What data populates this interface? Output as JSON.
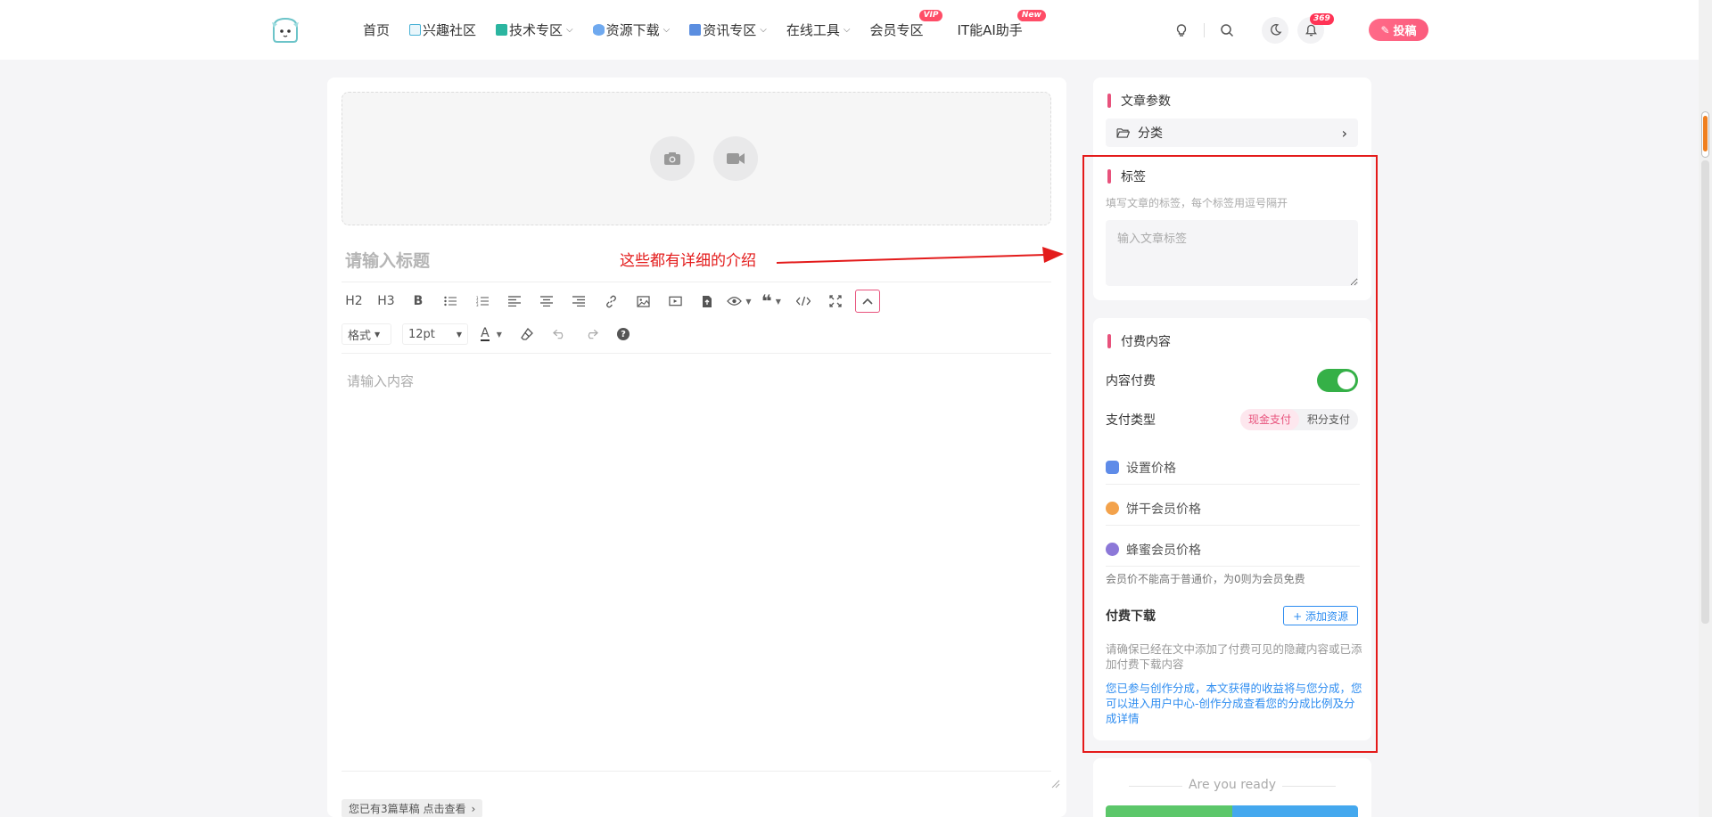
{
  "nav": {
    "home": "首页",
    "community": "兴趣社区",
    "tech": "技术专区",
    "resources": "资源下载",
    "news": "资讯专区",
    "tools": "在线工具",
    "vip": "会员专区",
    "vip_badge": "VIP",
    "ai": "IT能AI助手",
    "ai_badge": "New"
  },
  "header": {
    "notification_count": "369",
    "post_label": "投稿"
  },
  "editor": {
    "title_placeholder": "请输入标题",
    "annotation": "这些都有详细的介绍",
    "toolbar": {
      "h2": "H2",
      "h3": "H3",
      "bold": "B",
      "format": "格式",
      "font_size": "12pt",
      "text_color": "A",
      "help": "?"
    },
    "content_placeholder": "请输入内容",
    "draft_notice": "您已有3篇草稿 点击查看"
  },
  "sidebar": {
    "params": {
      "title": "文章参数",
      "category_label": "分类"
    },
    "tags": {
      "title": "标签",
      "hint": "填写文章的标签，每个标签用逗号隔开",
      "placeholder": "输入文章标签"
    },
    "paid": {
      "title": "付费内容",
      "paid_label": "内容付费",
      "paid_enabled": true,
      "pay_type_label": "支付类型",
      "pay_options": [
        "现金支付",
        "积分支付"
      ],
      "pay_selected": "现金支付",
      "set_price": "设置价格",
      "biscuit_price": "饼干会员价格",
      "honey_price": "蜂蜜会员价格",
      "member_note": "会员价不能高于普通价，为0则为会员免费",
      "download_label": "付费下载",
      "add_resource": "+ 添加资源",
      "download_note": "请确保已经在文中添加了付费可见的隐藏内容或已添加付费下载内容",
      "share_note": "您已参与创作分成，本文获得的收益将与您分成，您可以进入用户中心-创作分成查看您的分成比例及分成详情"
    },
    "ready": "Are you ready"
  },
  "colors": {
    "accent_pink": "#e8527c",
    "annotation_red": "#e31b1b",
    "toggle_green": "#35b047",
    "link_blue": "#2d8cf0"
  }
}
